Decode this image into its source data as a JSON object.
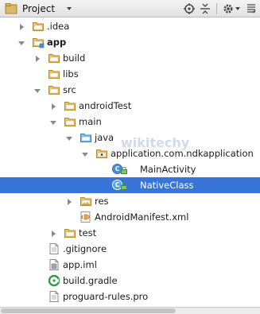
{
  "header": {
    "title": "Project"
  },
  "watermark": "wikitechy",
  "tree": [
    {
      "label": "app",
      "bold": true
    },
    {
      "label": ".idea"
    },
    {
      "label": "build"
    },
    {
      "label": "libs"
    },
    {
      "label": "src"
    },
    {
      "label": "androidTest"
    },
    {
      "label": "main"
    },
    {
      "label": "java"
    },
    {
      "label": "application.com.ndkapplication"
    },
    {
      "label": "MainActivity"
    },
    {
      "label": "NativeClass",
      "selected": true
    },
    {
      "label": "res"
    },
    {
      "label": "AndroidManifest.xml"
    },
    {
      "label": "test"
    },
    {
      "label": ".gitignore"
    },
    {
      "label": "app.iml"
    },
    {
      "label": "build.gradle"
    },
    {
      "label": "proguard-rules.pro"
    },
    {
      "label": "build"
    }
  ]
}
